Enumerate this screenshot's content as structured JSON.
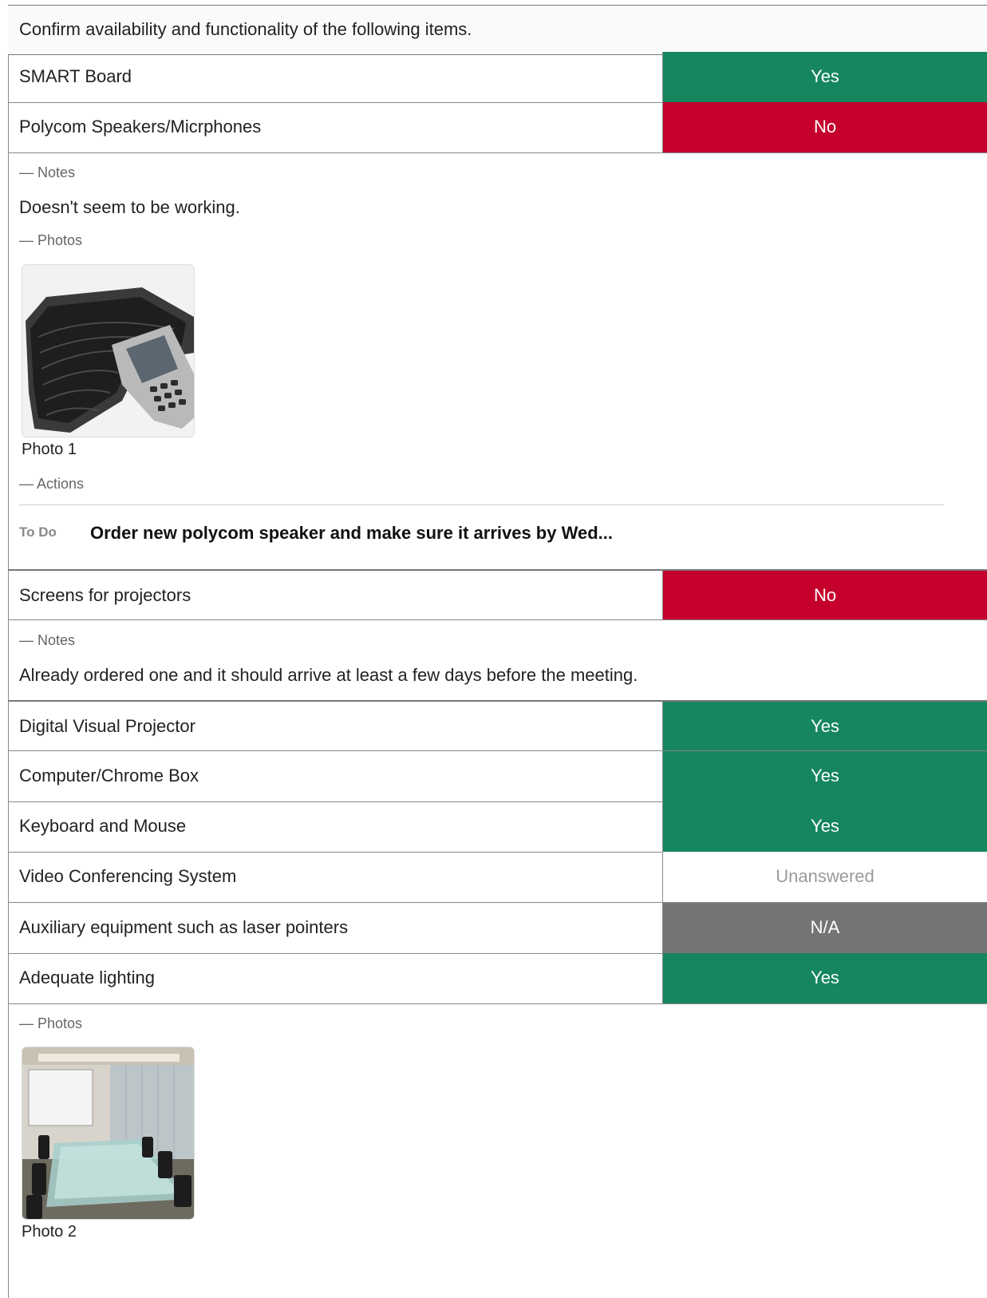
{
  "header": {
    "text": "Confirm availability and functionality of the following items."
  },
  "items": [
    {
      "label": "SMART Board",
      "answer": "Yes"
    },
    {
      "label": "Polycom Speakers/Micrphones",
      "answer": "No",
      "notes_heading": "— Notes",
      "note": "Doesn't seem to be working.",
      "photos_heading": "— Photos",
      "photo_caption": "Photo 1",
      "actions_heading": "— Actions",
      "todo_tag": "To Do",
      "todo_text": "Order new polycom speaker and make sure it arrives by Wed..."
    },
    {
      "label": "Screens for projectors",
      "answer": "No",
      "notes_heading": "— Notes",
      "note": "Already ordered one and it should arrive at least a few days before the meeting."
    },
    {
      "label": "Digital Visual Projector",
      "answer": "Yes"
    },
    {
      "label": "Computer/Chrome Box",
      "answer": "Yes"
    },
    {
      "label": "Keyboard and Mouse",
      "answer": "Yes"
    },
    {
      "label": "Video Conferencing System",
      "answer": "Unanswered"
    },
    {
      "label": "Auxiliary equipment such as laser pointers",
      "answer": "N/A"
    },
    {
      "label": "Adequate lighting",
      "answer": "Yes",
      "photos_heading": "— Photos",
      "photo_caption": "Photo 2"
    }
  ],
  "colors": {
    "yes": "#15865e",
    "no": "#c5002d",
    "na": "#747474",
    "unanswered_text": "#9a9a9a"
  },
  "icons": {
    "photo1": "conference-speakerphone-photo",
    "photo2": "meeting-room-photo"
  }
}
